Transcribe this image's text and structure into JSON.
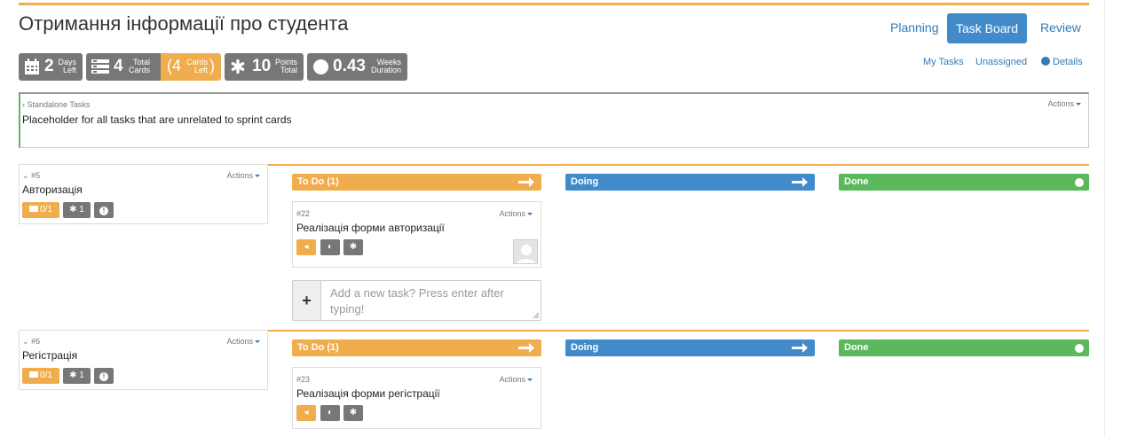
{
  "header": {
    "title": "Отримання інформації про студента",
    "nav": {
      "planning": "Planning",
      "taskboard": "Task Board",
      "review": "Review"
    },
    "sublinks": {
      "my_tasks": "My Tasks",
      "unassigned": "Unassigned",
      "details": "Details"
    }
  },
  "stats": {
    "days": {
      "value": "2",
      "top": "Days",
      "bottom": "Left"
    },
    "cards": {
      "value": "4",
      "top": "Total",
      "bottom": "Cards"
    },
    "cards_left": {
      "open": "(4",
      "top": "Cards",
      "bottom": "Left",
      "close": ")"
    },
    "points": {
      "value": "10",
      "top": "Points",
      "bottom": "Total"
    },
    "weeks": {
      "value": "0.43",
      "top": "Weeks",
      "bottom": "Duration"
    }
  },
  "standalone": {
    "heading": "Standalone Tasks",
    "actions": "Actions",
    "description": "Placeholder for all tasks that are unrelated to sprint cards"
  },
  "columns": {
    "todo": "To Do (1)",
    "doing": "Doing",
    "done": "Done"
  },
  "stories": [
    {
      "number": "#5",
      "actions": "Actions",
      "title": "Авторизація",
      "tasks_badge": "0/1",
      "points_badge": "1",
      "task": {
        "number": "#22",
        "actions": "Actions",
        "title": "Реалізація форми авторизації"
      }
    },
    {
      "number": "#6",
      "actions": "Actions",
      "title": "Регістрація",
      "tasks_badge": "0/1",
      "points_badge": "1",
      "task": {
        "number": "#23",
        "actions": "Actions",
        "title": "Реалізація форми регістрації"
      }
    }
  ],
  "add_task": {
    "plus": "+",
    "placeholder": "Add a new task? Press enter after typing!"
  },
  "colors": {
    "orange": "#f0ad4e",
    "blue": "#428bca",
    "green": "#5cb85c",
    "grey": "#777777"
  }
}
